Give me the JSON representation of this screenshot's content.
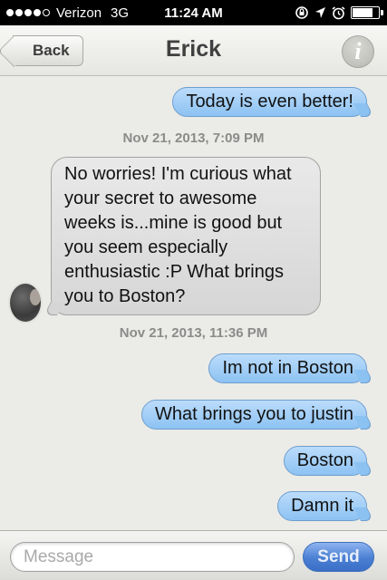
{
  "status_bar": {
    "carrier": "Verizon",
    "network": "3G",
    "time": "11:24 AM",
    "battery_level": 0.8,
    "signal_strength": 4,
    "icons": [
      "rotation-lock-icon",
      "location-icon",
      "alarm-icon",
      "battery-icon"
    ]
  },
  "nav": {
    "back_label": "Back",
    "title": "Erick",
    "info_label": "i"
  },
  "messages": [
    {
      "direction": "sent",
      "text": "Today is even better!"
    },
    {
      "direction": "timestamp",
      "text": "Nov 21, 2013, 7:09 PM"
    },
    {
      "direction": "received",
      "lines": [
        "No worries! I'm curious what",
        "your secret to awesome",
        "weeks is...mine is good but",
        "you seem especially",
        "enthusiastic :P What brings",
        "you to Boston?"
      ]
    },
    {
      "direction": "timestamp",
      "text": "Nov 21, 2013, 11:36 PM"
    },
    {
      "direction": "sent",
      "text": "Im not in Boston"
    },
    {
      "direction": "sent",
      "text": "What brings you to justin"
    },
    {
      "direction": "sent",
      "text": "Boston"
    },
    {
      "direction": "sent",
      "text": "Damn it"
    }
  ],
  "compose": {
    "placeholder": "Message",
    "send_label": "Send"
  },
  "colors": {
    "sent_bubble": "#8cc2f2",
    "received_bubble": "#d6d6d6",
    "send_button": "#4a7fd3",
    "background": "#ebebe7"
  }
}
